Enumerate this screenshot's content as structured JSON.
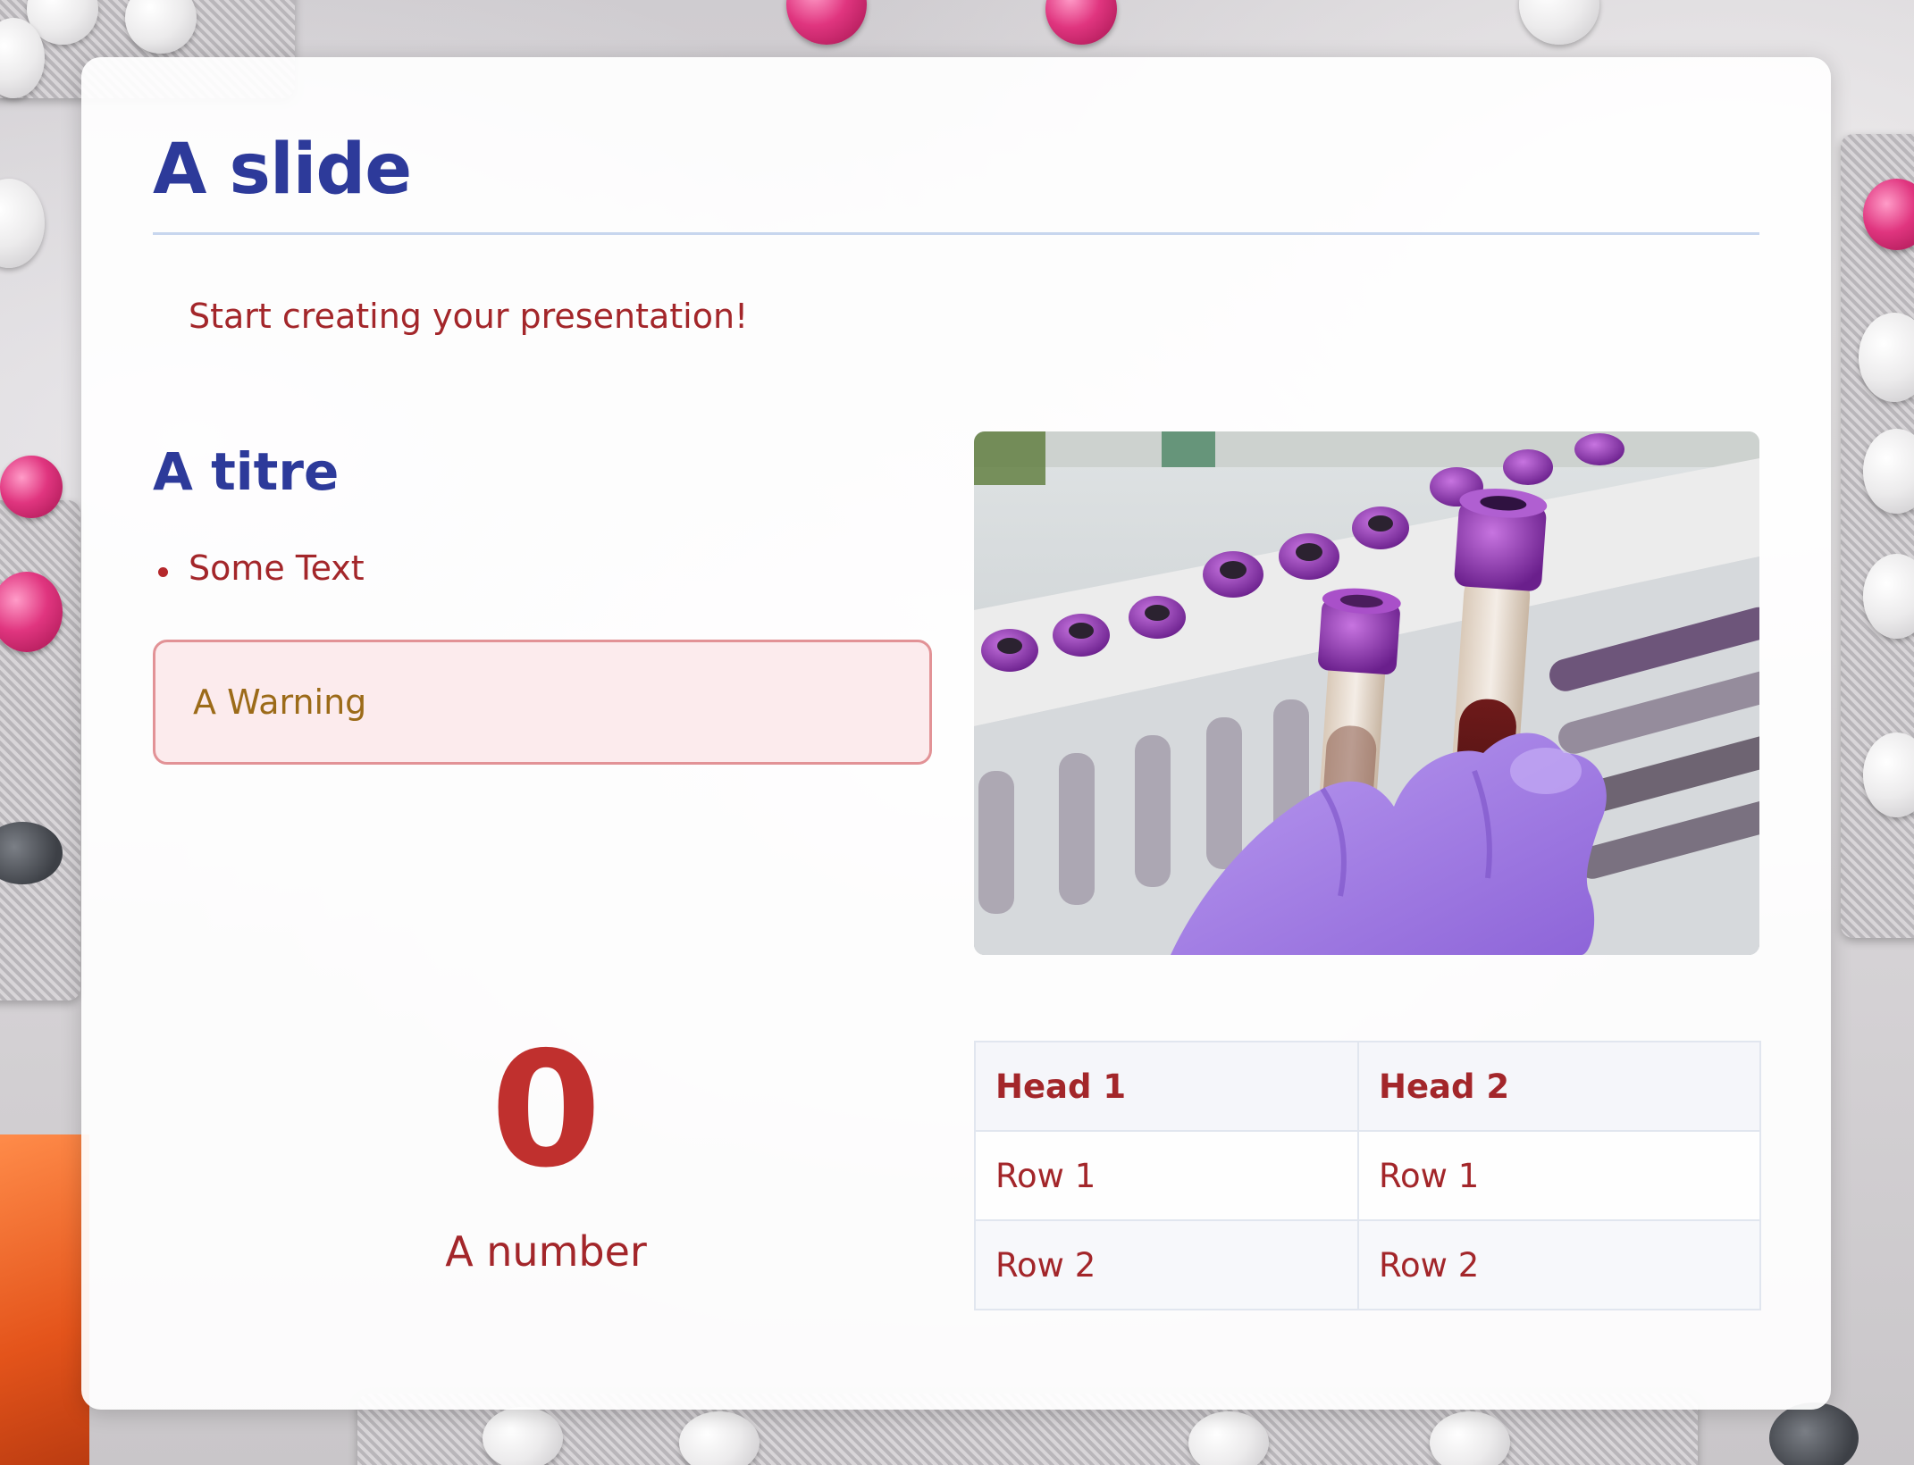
{
  "slide": {
    "title": "A slide",
    "intro": "Start creating your presentation!"
  },
  "section": {
    "title": "A titre",
    "bullets": [
      "Some Text"
    ]
  },
  "warning": {
    "text": "A Warning"
  },
  "kpi": {
    "value": "0",
    "label": "A number"
  },
  "table": {
    "headers": [
      "Head 1",
      "Head 2"
    ],
    "rows": [
      [
        "Row 1",
        "Row 1"
      ],
      [
        "Row 2",
        "Row 2"
      ]
    ]
  },
  "image": {
    "subject": "gloved hand holding blood sample tubes with purple caps"
  },
  "colors": {
    "title": "#2d3a9a",
    "text": "#a3262a",
    "accent_number": "#c0302e",
    "warning_text": "#9c6b19",
    "warning_bg": "#fcebed",
    "warning_border": "#e29296",
    "rule": "#c7d6ee"
  }
}
